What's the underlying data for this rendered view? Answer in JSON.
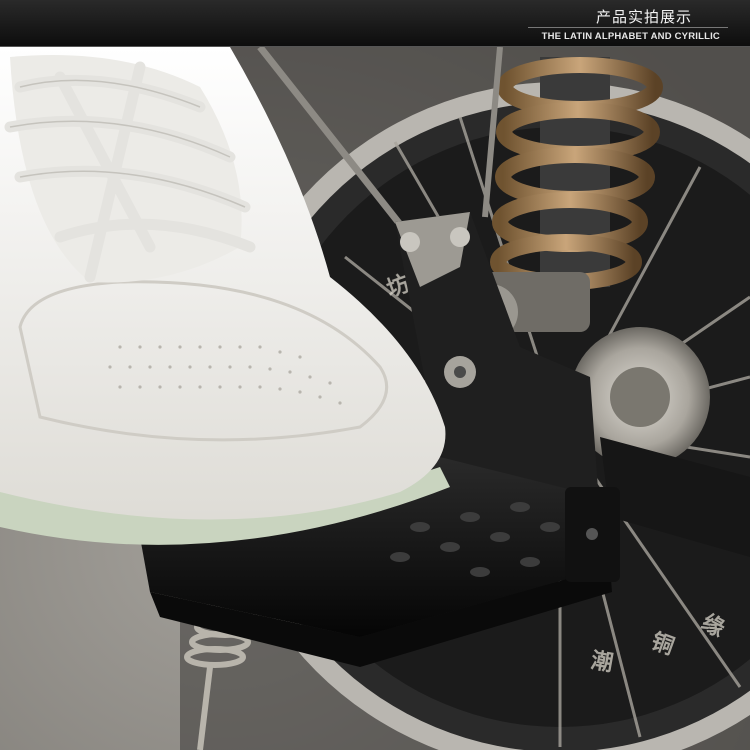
{
  "header": {
    "title": "产品实拍展示",
    "subtitle": "THE LATIN ALPHABET AND CYRILLIC"
  },
  "photo": {
    "subject": "white-sneaker-on-folding-motorcycle-footrest",
    "colors": {
      "ground": "#8f8c86",
      "disc": "#1e1e1e",
      "rim": "#b9b6b0",
      "spring": "#9a7a4c",
      "footrest": "#121212",
      "shoe": "#f2f1ed",
      "sole_edge": "#c9d4bf"
    }
  }
}
